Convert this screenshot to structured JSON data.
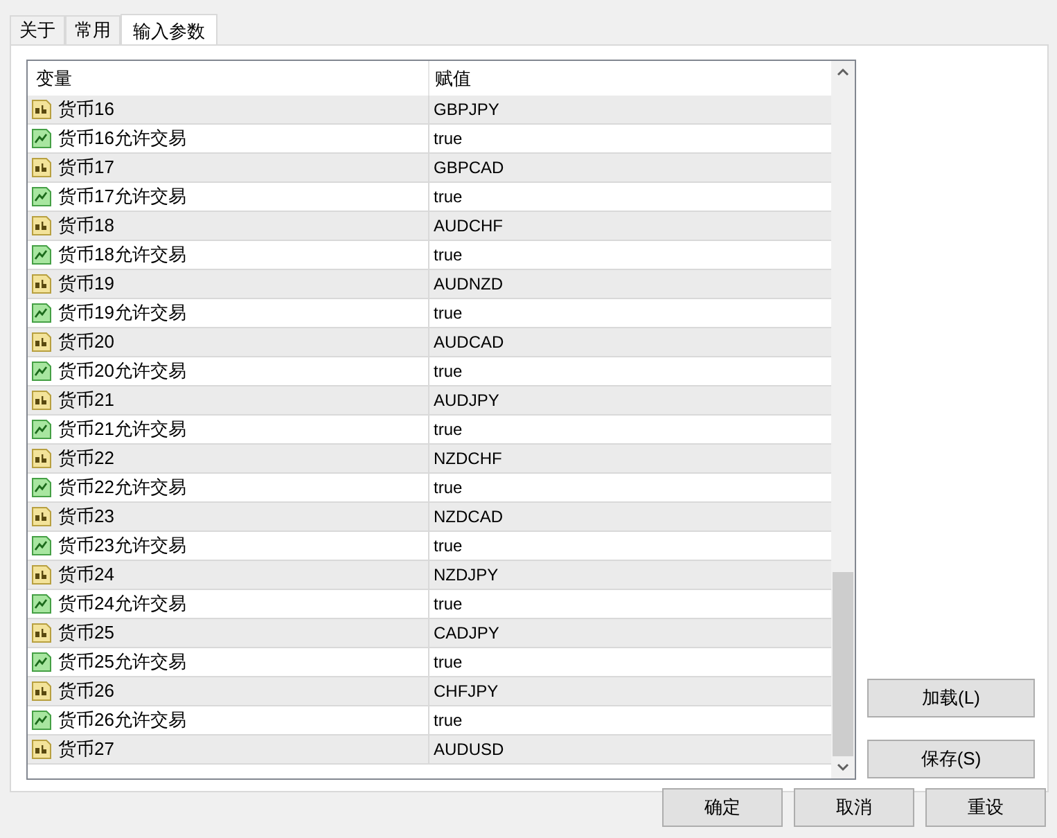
{
  "tabs": [
    {
      "label": "关于",
      "selected": false
    },
    {
      "label": "常用",
      "selected": false
    },
    {
      "label": "输入参数",
      "selected": true
    }
  ],
  "table": {
    "columns": [
      "变量",
      "赋值"
    ],
    "rows": [
      {
        "kind": "string",
        "name": "货币16",
        "value": "GBPJPY"
      },
      {
        "kind": "bool",
        "name": "货币16允许交易",
        "value": "true"
      },
      {
        "kind": "string",
        "name": "货币17",
        "value": "GBPCAD"
      },
      {
        "kind": "bool",
        "name": "货币17允许交易",
        "value": "true"
      },
      {
        "kind": "string",
        "name": "货币18",
        "value": "AUDCHF"
      },
      {
        "kind": "bool",
        "name": "货币18允许交易",
        "value": "true"
      },
      {
        "kind": "string",
        "name": "货币19",
        "value": "AUDNZD"
      },
      {
        "kind": "bool",
        "name": "货币19允许交易",
        "value": "true"
      },
      {
        "kind": "string",
        "name": "货币20",
        "value": "AUDCAD"
      },
      {
        "kind": "bool",
        "name": "货币20允许交易",
        "value": "true"
      },
      {
        "kind": "string",
        "name": "货币21",
        "value": "AUDJPY"
      },
      {
        "kind": "bool",
        "name": "货币21允许交易",
        "value": "true"
      },
      {
        "kind": "string",
        "name": "货币22",
        "value": "NZDCHF"
      },
      {
        "kind": "bool",
        "name": "货币22允许交易",
        "value": "true"
      },
      {
        "kind": "string",
        "name": "货币23",
        "value": "NZDCAD"
      },
      {
        "kind": "bool",
        "name": "货币23允许交易",
        "value": "true"
      },
      {
        "kind": "string",
        "name": "货币24",
        "value": "NZDJPY"
      },
      {
        "kind": "bool",
        "name": "货币24允许交易",
        "value": "true"
      },
      {
        "kind": "string",
        "name": "货币25",
        "value": "CADJPY"
      },
      {
        "kind": "bool",
        "name": "货币25允许交易",
        "value": "true"
      },
      {
        "kind": "string",
        "name": "货币26",
        "value": "CHFJPY"
      },
      {
        "kind": "bool",
        "name": "货币26允许交易",
        "value": "true"
      },
      {
        "kind": "string",
        "name": "货币27",
        "value": "AUDUSD"
      }
    ]
  },
  "side_buttons": [
    "加载(L)",
    "保存(S)"
  ],
  "buttons": [
    "确定",
    "取消",
    "重设"
  ]
}
